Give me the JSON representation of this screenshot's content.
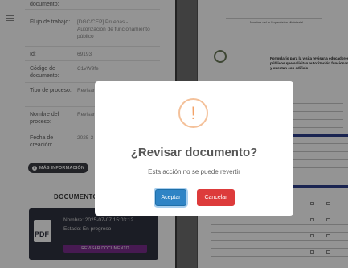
{
  "info": {
    "top_cut_label": "documento:",
    "workflow_label": "Flujo de trabajo:",
    "workflow_value": "[DGC/CEP] Pruebas - Autorización de funcionamiento público",
    "id_label": "Id:",
    "id_value": "69193",
    "doc_code_label": "Código de documento:",
    "doc_code_value": "C1vW9fe",
    "process_type_label": "Tipo de proceso:",
    "process_type_value": "Revisar",
    "process_name_label": "Nombre del proceso:",
    "process_name_value": "Revisar informe",
    "created_label": "Fecha de creación:",
    "created_value": "2025-3"
  },
  "more_info_button": "MÁS INFORMACIÓN",
  "documents": {
    "title": "DOCUMENTOS",
    "card": {
      "pdf_label": "PDF",
      "name": "Nombre: 2025-07-07 15:03:12",
      "status": "Estado: En progreso",
      "review_button": "REVISAR DOCUMENTO"
    }
  },
  "viewer": {
    "header_text": "Nombre del la Supervisión Ministerial",
    "form_title": "Formulario para la visita revisar a educadores públicos que solicitan autorización funcionamiento y cuentan con edificio",
    "section_label": "Datos generales"
  },
  "modal": {
    "icon_glyph": "!",
    "title": "¿Revisar documento?",
    "text": "Esta acción no se puede revertir",
    "accept_label": "Aceptar",
    "cancel_label": "Cancelar"
  },
  "colors": {
    "accept": "#2f84c5",
    "cancel": "#dd3b3b",
    "warning": "#f3a267",
    "review_button": "#7b2d8e"
  }
}
